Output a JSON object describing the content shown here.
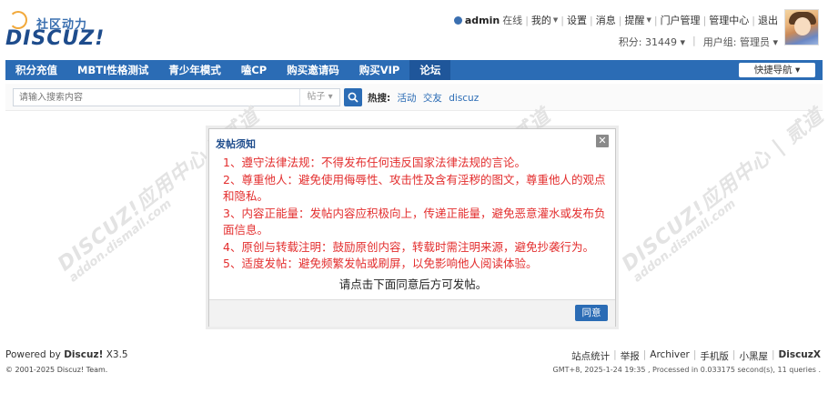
{
  "header": {
    "logo_slogan": "社区动力",
    "logo_brand": "DISCUZ!",
    "username": "admin",
    "status": "在线",
    "links": [
      "我的",
      "设置",
      "消息",
      "提醒",
      "门户管理",
      "管理中心",
      "退出"
    ],
    "credits": "积分: 31449",
    "user_group": "用户组: 管理员"
  },
  "nav": {
    "items": [
      "积分充值",
      "MBTI性格测试",
      "青少年模式",
      "嗑CP",
      "购买邀请码",
      "购买VIP",
      "论坛"
    ],
    "active_index": 6,
    "quick_nav": "快捷导航"
  },
  "search": {
    "placeholder": "请输入搜索内容",
    "type": "帖子",
    "hot_label": "热搜:",
    "hot_terms": [
      "活动",
      "交友",
      "discuz"
    ]
  },
  "watermark": {
    "line1": "DISCUZ!应用中心 | 贰道",
    "line2": "addon.dismall.com"
  },
  "dialog": {
    "title": "发帖须知",
    "rules": [
      "1、遵守法律法规：不得发布任何违反国家法律法规的言论。",
      "2、尊重他人：避免使用侮辱性、攻击性及含有淫秽的图文，尊重他人的观点和隐私。",
      "3、内容正能量：发帖内容应积极向上，传递正能量，避免恶意灌水或发布负面信息。",
      "4、原创与转载注明：鼓励原创内容，转载时需注明来源，避免抄袭行为。",
      "5、适度发帖：避免频繁发帖或刷屏，以免影响他人阅读体验。"
    ],
    "prompt": "请点击下面同意后方可发帖。",
    "agree": "同意"
  },
  "footer": {
    "powered_prefix": "Powered by",
    "powered_brand": "Discuz!",
    "powered_version": "X3.5",
    "copyright": "© 2001-2025 Discuz! Team.",
    "links": [
      "站点统计",
      "举报",
      "Archiver",
      "手机版",
      "小黑屋"
    ],
    "brand": "DiscuzX",
    "info": "GMT+8, 2025-1-24 19:35 , Processed in 0.033175 second(s), 11 queries ."
  },
  "colors": {
    "nav_bg": "#2b6cb5",
    "nav_active": "#1f569a",
    "rule_text": "#e32e2e",
    "brand": "#1e4c8c"
  }
}
